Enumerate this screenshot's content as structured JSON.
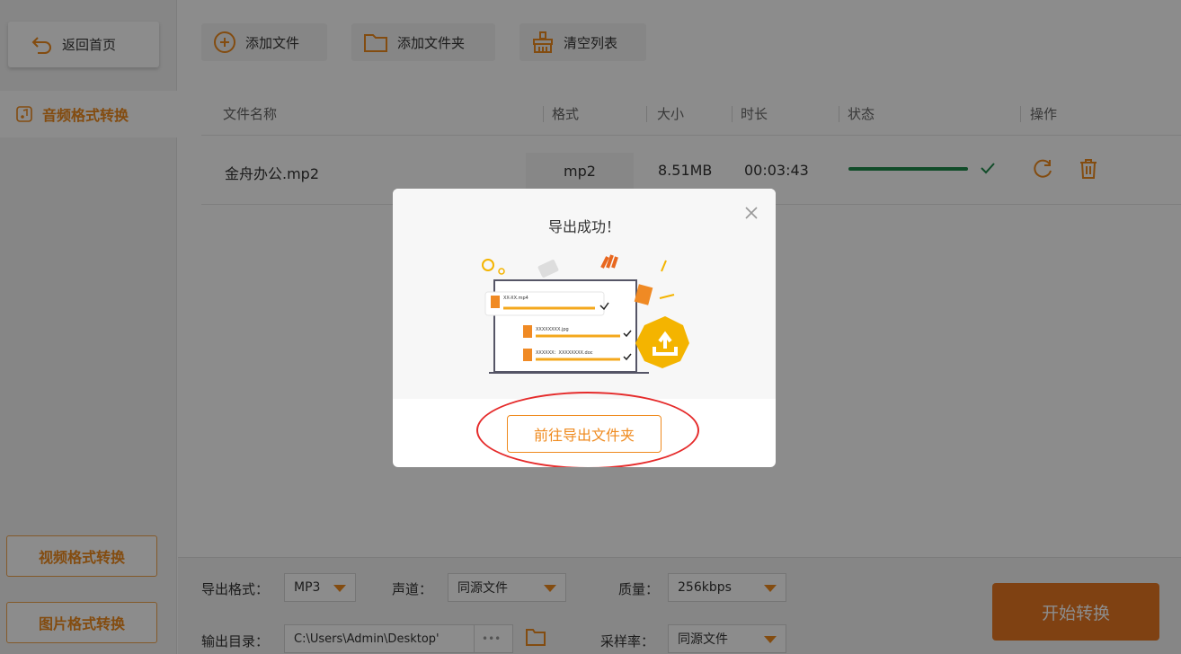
{
  "sidebar": {
    "back_label": "返回首页",
    "active_item": "音频格式转换",
    "video_btn": "视频格式转换",
    "image_btn": "图片格式转换"
  },
  "toolbar": {
    "add_file": "添加文件",
    "add_folder": "添加文件夹",
    "clear_list": "清空列表"
  },
  "table": {
    "headers": [
      "文件名称",
      "格式",
      "大小",
      "时长",
      "状态",
      "操作"
    ],
    "rows": [
      {
        "name": "金舟办公.mp2",
        "format": "mp2",
        "size": "8.51MB",
        "duration": "00:03:43",
        "progress": 1.0
      }
    ]
  },
  "bottom": {
    "export_format_label": "导出格式：",
    "export_format_value": "MP3",
    "channel_label": "声道：",
    "channel_value": "同源文件",
    "quality_label": "质量：",
    "quality_value": "256kbps",
    "output_dir_label": "输出目录：",
    "output_dir_value": "C:\\Users\\Admin\\Desktop'",
    "more_label": "•••",
    "sample_rate_label": "采样率：",
    "sample_rate_value": "同源文件",
    "start_label": "开始转换"
  },
  "modal": {
    "title": "导出成功！",
    "goto_label": "前往导出文件夹",
    "illus_file1": "XX-XX.mp4",
    "illus_file2": "XXXXXXXX.jpg",
    "illus_file3": "XXXXXX：XXXXXXXX.doc"
  },
  "colors": {
    "accent": "#ef8a1e",
    "start_button": "#e87722",
    "progress": "#1f8a4c",
    "highlight_ellipse": "#e52b2b"
  }
}
